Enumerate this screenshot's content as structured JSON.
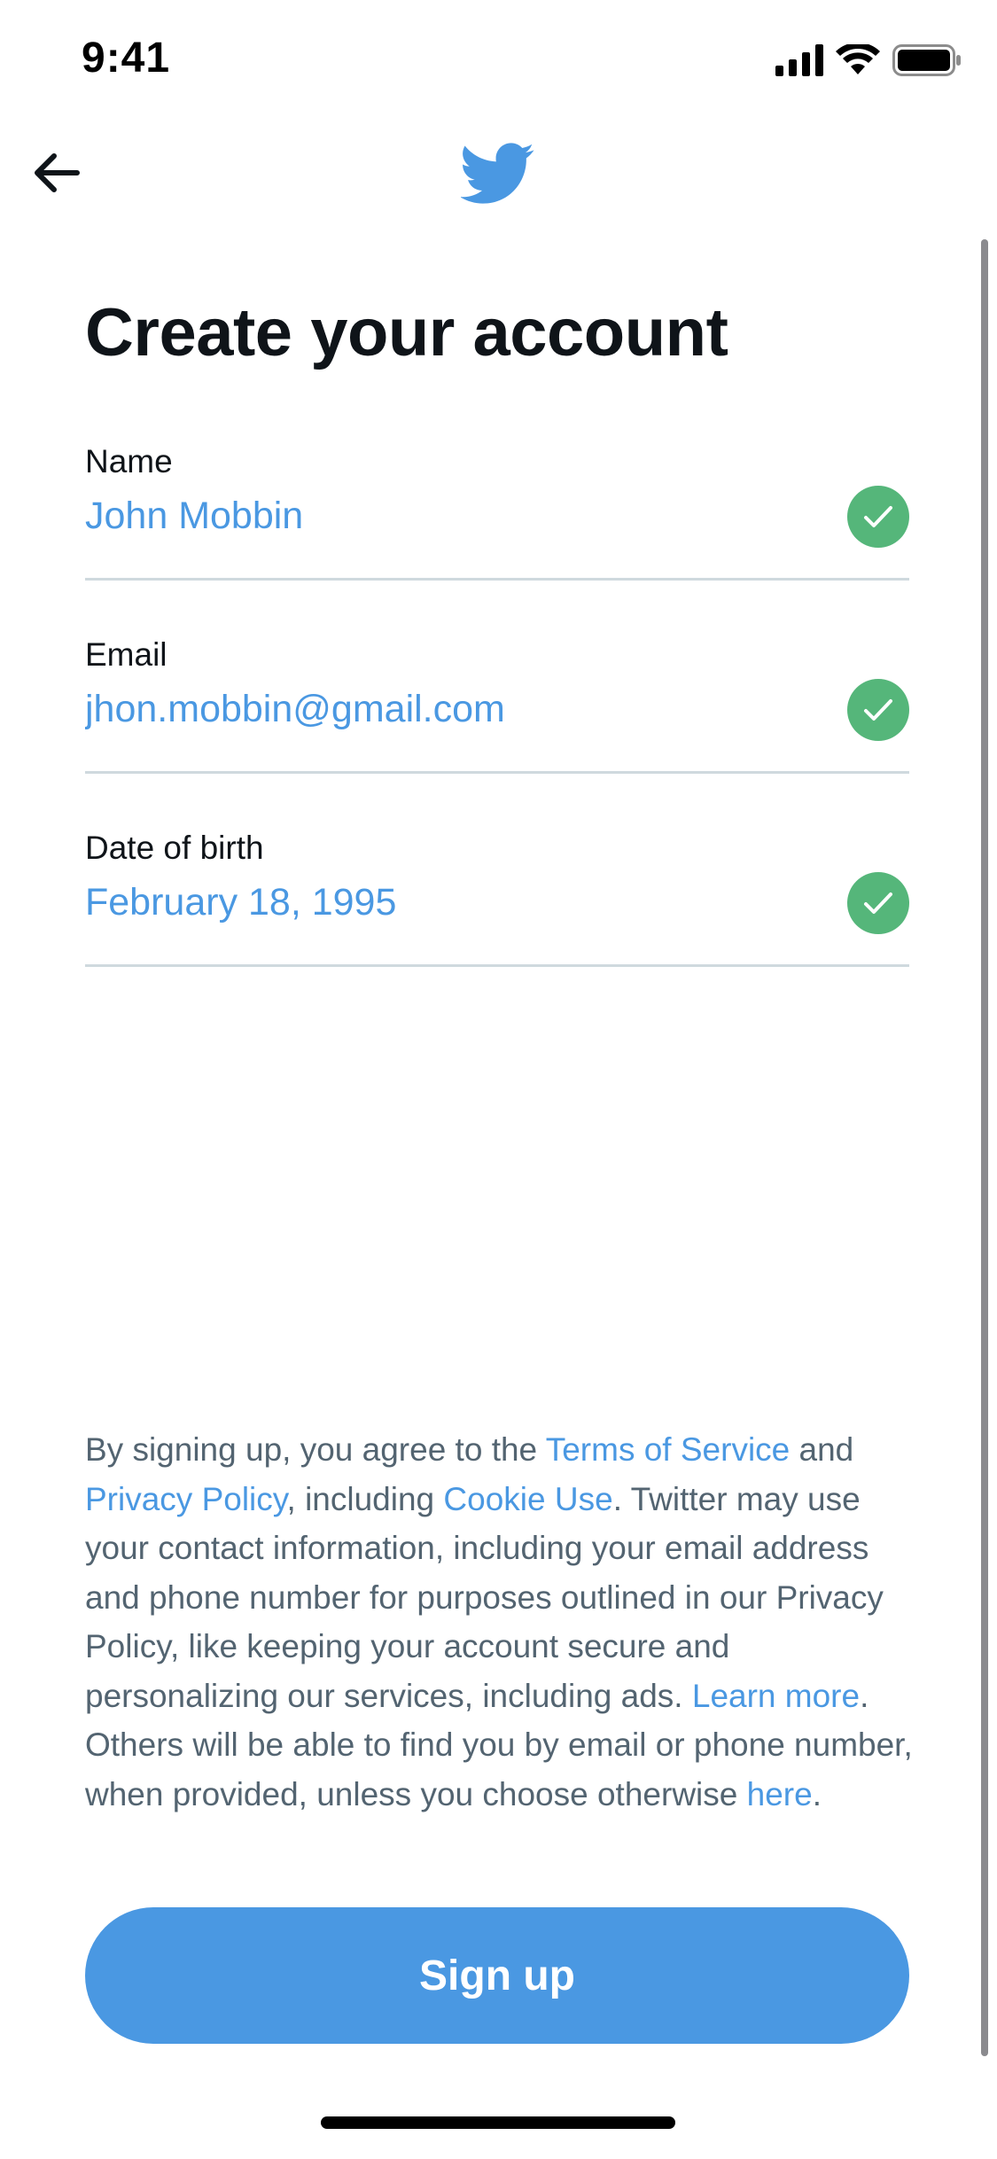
{
  "status_bar": {
    "time": "9:41"
  },
  "nav": {
    "back_icon": "arrow-left-icon",
    "logo_icon": "twitter-bird-icon"
  },
  "page": {
    "title": "Create your account"
  },
  "form": {
    "fields": [
      {
        "label": "Name",
        "value": "John Mobbin",
        "status_icon": "check-icon"
      },
      {
        "label": "Email",
        "value": "jhon.mobbin@gmail.com",
        "status_icon": "check-icon"
      },
      {
        "label": "Date of birth",
        "value": "February 18, 1995",
        "status_icon": "check-icon"
      }
    ]
  },
  "legal": {
    "t1": "By signing up, you agree to the ",
    "terms_link": "Terms of Service",
    "t2": " and ",
    "privacy_link": "Privacy Policy",
    "t3": ", including ",
    "cookie_link": "Cookie Use",
    "t4": ". Twitter may use your contact information, including your email address and phone number for purposes outlined in our Privacy Policy, like keeping your account secure and personalizing our services, including ads. ",
    "learn_more_link": "Learn more",
    "t5": ". Others will be able to find you by email or phone number, when provided, unless you choose otherwise ",
    "here_link": "here",
    "t6": "."
  },
  "actions": {
    "signup_label": "Sign up"
  },
  "colors": {
    "accent": "#4a98e2",
    "success": "#55b67a",
    "text_primary": "#0f1419",
    "text_secondary": "#536471",
    "divider": "#cfd9de"
  }
}
